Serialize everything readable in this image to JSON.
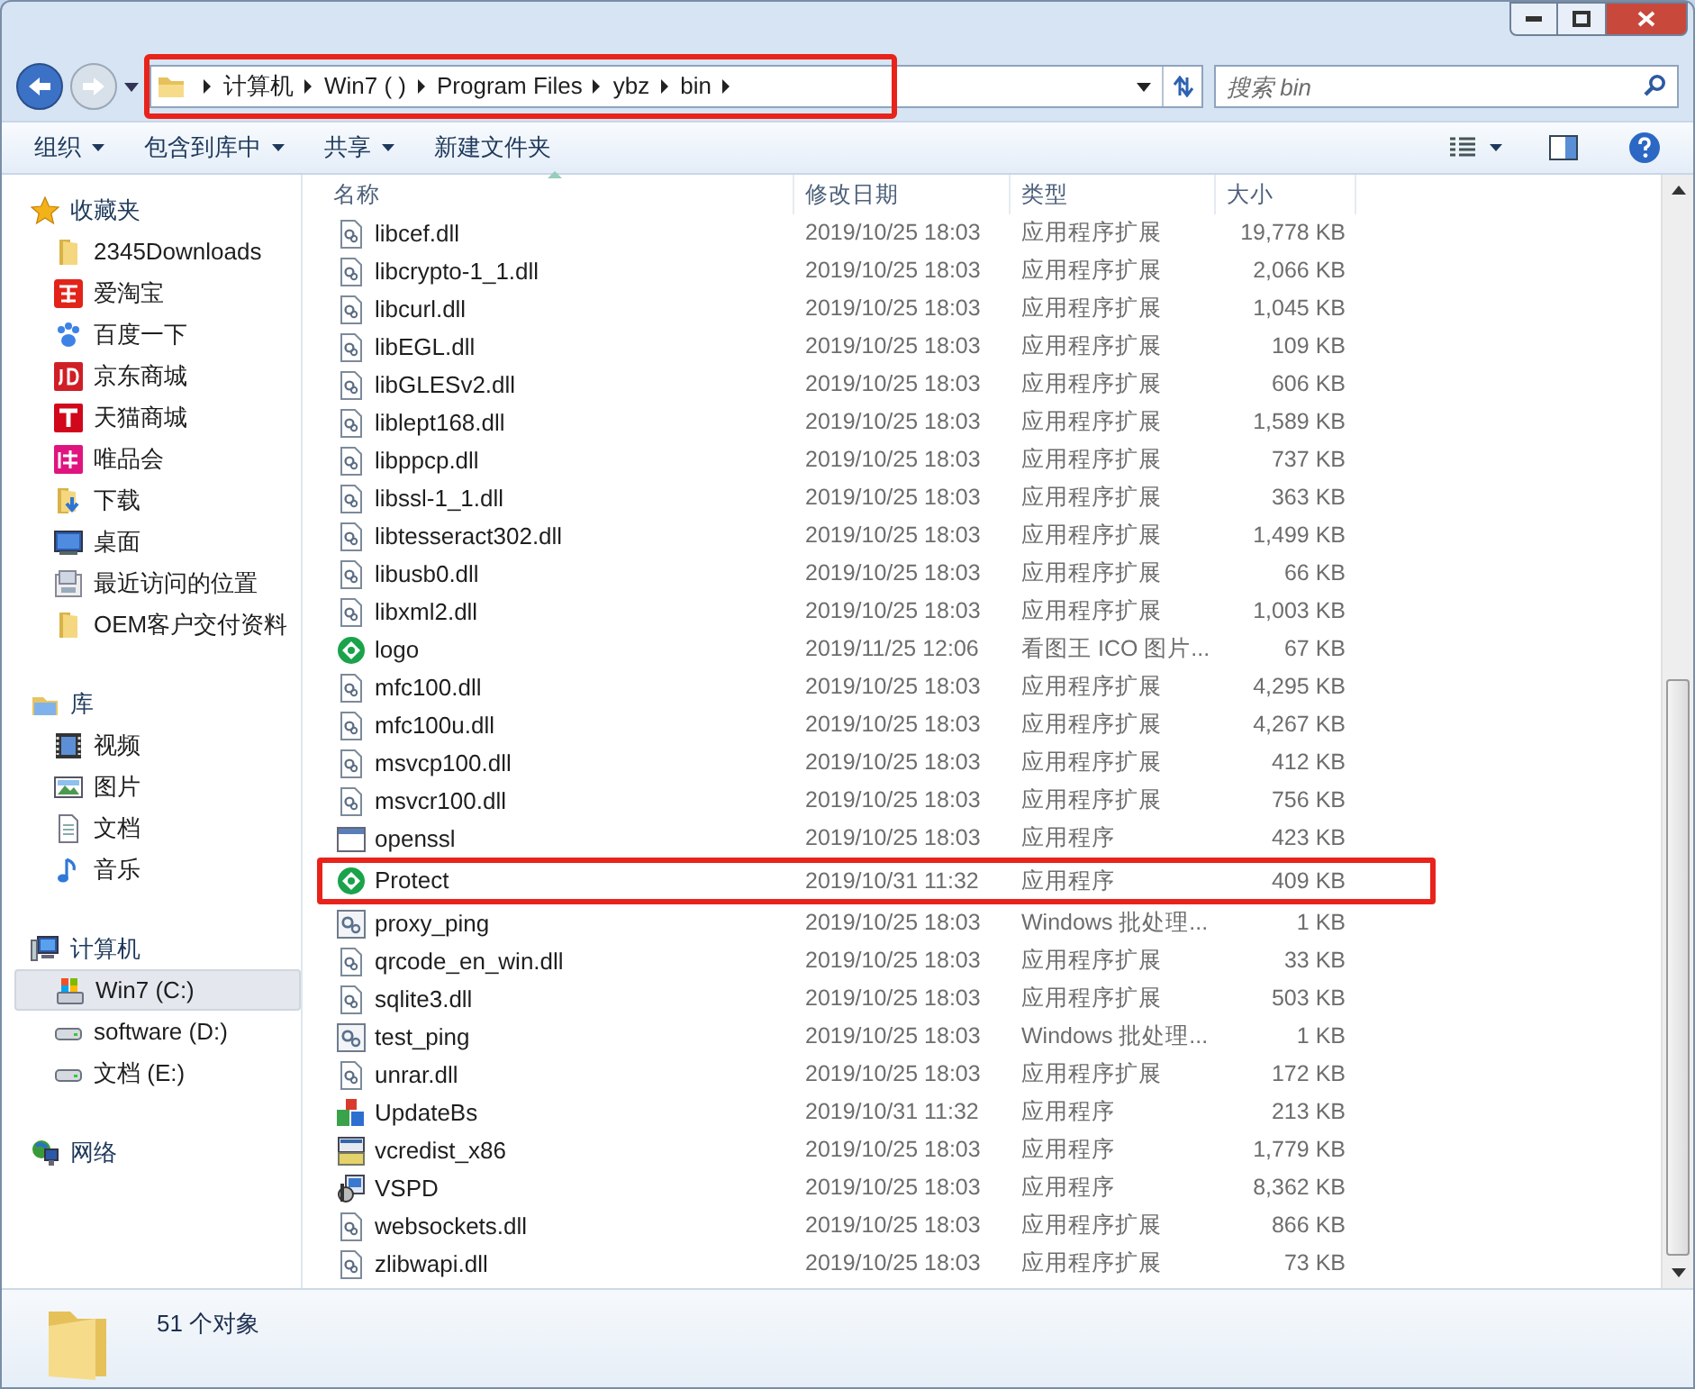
{
  "address_bar": {
    "highlighted": true,
    "segments": [
      "计算机",
      "Win7 ( )",
      "Program Files",
      "ybz",
      "bin"
    ]
  },
  "search": {
    "placeholder": "搜索 bin"
  },
  "toolbar": [
    {
      "label": "组织",
      "dropdown": true
    },
    {
      "label": "包含到库中",
      "dropdown": true
    },
    {
      "label": "共享",
      "dropdown": true
    },
    {
      "label": "新建文件夹",
      "dropdown": false
    }
  ],
  "sidebar": [
    {
      "label": "收藏夹",
      "kind": "star",
      "selected": false,
      "children": [
        {
          "label": "2345Downloads",
          "kind": "folder",
          "selected": false
        },
        {
          "label": "爱淘宝",
          "kind": "taobao",
          "selected": false
        },
        {
          "label": "百度一下",
          "kind": "paw",
          "selected": false
        },
        {
          "label": "京东商城",
          "kind": "jd",
          "selected": false
        },
        {
          "label": "天猫商城",
          "kind": "tmall",
          "selected": false
        },
        {
          "label": "唯品会",
          "kind": "vip",
          "selected": false
        },
        {
          "label": "下载",
          "kind": "download",
          "selected": false
        },
        {
          "label": "桌面",
          "kind": "desktop",
          "selected": false
        },
        {
          "label": "最近访问的位置",
          "kind": "recent",
          "selected": false
        },
        {
          "label": "OEM客户交付资料",
          "kind": "folder",
          "selected": false
        }
      ]
    },
    {
      "label": "库",
      "kind": "library",
      "selected": false,
      "children": [
        {
          "label": "视频",
          "kind": "film",
          "selected": false
        },
        {
          "label": "图片",
          "kind": "image",
          "selected": false
        },
        {
          "label": "文档",
          "kind": "doc",
          "selected": false
        },
        {
          "label": "音乐",
          "kind": "music",
          "selected": false
        }
      ]
    },
    {
      "label": "计算机",
      "kind": "computer",
      "selected": false,
      "children": [
        {
          "label": "Win7 (C:)",
          "kind": "sysdrive",
          "selected": true
        },
        {
          "label": "software (D:)",
          "kind": "drive",
          "selected": false
        },
        {
          "label": "文档 (E:)",
          "kind": "drive",
          "selected": false
        }
      ]
    },
    {
      "label": "网络",
      "kind": "network",
      "selected": false
    }
  ],
  "table": {
    "columns": [
      "名称",
      "修改日期",
      "类型",
      "大小"
    ],
    "rows": [
      {
        "name": "libcef.dll",
        "kind": "dll",
        "date": "2019/10/25 18:03",
        "type": "应用程序扩展",
        "size": "19,778 KB",
        "highlighted": false
      },
      {
        "name": "libcrypto-1_1.dll",
        "kind": "dll",
        "date": "2019/10/25 18:03",
        "type": "应用程序扩展",
        "size": "2,066 KB",
        "highlighted": false
      },
      {
        "name": "libcurl.dll",
        "kind": "dll",
        "date": "2019/10/25 18:03",
        "type": "应用程序扩展",
        "size": "1,045 KB",
        "highlighted": false
      },
      {
        "name": "libEGL.dll",
        "kind": "dll",
        "date": "2019/10/25 18:03",
        "type": "应用程序扩展",
        "size": "109 KB",
        "highlighted": false
      },
      {
        "name": "libGLESv2.dll",
        "kind": "dll",
        "date": "2019/10/25 18:03",
        "type": "应用程序扩展",
        "size": "606 KB",
        "highlighted": false
      },
      {
        "name": "liblept168.dll",
        "kind": "dll",
        "date": "2019/10/25 18:03",
        "type": "应用程序扩展",
        "size": "1,589 KB",
        "highlighted": false
      },
      {
        "name": "libppcp.dll",
        "kind": "dll",
        "date": "2019/10/25 18:03",
        "type": "应用程序扩展",
        "size": "737 KB",
        "highlighted": false
      },
      {
        "name": "libssl-1_1.dll",
        "kind": "dll",
        "date": "2019/10/25 18:03",
        "type": "应用程序扩展",
        "size": "363 KB",
        "highlighted": false
      },
      {
        "name": "libtesseract302.dll",
        "kind": "dll",
        "date": "2019/10/25 18:03",
        "type": "应用程序扩展",
        "size": "1,499 KB",
        "highlighted": false
      },
      {
        "name": "libusb0.dll",
        "kind": "dll",
        "date": "2019/10/25 18:03",
        "type": "应用程序扩展",
        "size": "66 KB",
        "highlighted": false
      },
      {
        "name": "libxml2.dll",
        "kind": "dll",
        "date": "2019/10/25 18:03",
        "type": "应用程序扩展",
        "size": "1,003 KB",
        "highlighted": false
      },
      {
        "name": "logo",
        "kind": "ring",
        "date": "2019/11/25 12:06",
        "type": "看图王 ICO 图片...",
        "size": "67 KB",
        "highlighted": false
      },
      {
        "name": "mfc100.dll",
        "kind": "dll",
        "date": "2019/10/25 18:03",
        "type": "应用程序扩展",
        "size": "4,295 KB",
        "highlighted": false
      },
      {
        "name": "mfc100u.dll",
        "kind": "dll",
        "date": "2019/10/25 18:03",
        "type": "应用程序扩展",
        "size": "4,267 KB",
        "highlighted": false
      },
      {
        "name": "msvcp100.dll",
        "kind": "dll",
        "date": "2019/10/25 18:03",
        "type": "应用程序扩展",
        "size": "412 KB",
        "highlighted": false
      },
      {
        "name": "msvcr100.dll",
        "kind": "dll",
        "date": "2019/10/25 18:03",
        "type": "应用程序扩展",
        "size": "756 KB",
        "highlighted": false
      },
      {
        "name": "openssl",
        "kind": "window",
        "date": "2019/10/25 18:03",
        "type": "应用程序",
        "size": "423 KB",
        "highlighted": false
      },
      {
        "name": "Protect",
        "kind": "ring",
        "date": "2019/10/31 11:32",
        "type": "应用程序",
        "size": "409 KB",
        "highlighted": true
      },
      {
        "name": "proxy_ping",
        "kind": "batch",
        "date": "2019/10/25 18:03",
        "type": "Windows 批处理...",
        "size": "1 KB",
        "highlighted": false
      },
      {
        "name": "qrcode_en_win.dll",
        "kind": "dll",
        "date": "2019/10/25 18:03",
        "type": "应用程序扩展",
        "size": "33 KB",
        "highlighted": false
      },
      {
        "name": "sqlite3.dll",
        "kind": "dll",
        "date": "2019/10/25 18:03",
        "type": "应用程序扩展",
        "size": "503 KB",
        "highlighted": false
      },
      {
        "name": "test_ping",
        "kind": "batch",
        "date": "2019/10/25 18:03",
        "type": "Windows 批处理...",
        "size": "1 KB",
        "highlighted": false
      },
      {
        "name": "unrar.dll",
        "kind": "dll",
        "date": "2019/10/25 18:03",
        "type": "应用程序扩展",
        "size": "172 KB",
        "highlighted": false
      },
      {
        "name": "UpdateBs",
        "kind": "blocks",
        "date": "2019/10/31 11:32",
        "type": "应用程序",
        "size": "213 KB",
        "highlighted": false
      },
      {
        "name": "vcredist_x86",
        "kind": "setup",
        "date": "2019/10/25 18:03",
        "type": "应用程序",
        "size": "1,779 KB",
        "highlighted": false
      },
      {
        "name": "VSPD",
        "kind": "installer",
        "date": "2019/10/25 18:03",
        "type": "应用程序",
        "size": "8,362 KB",
        "highlighted": false
      },
      {
        "name": "websockets.dll",
        "kind": "dll",
        "date": "2019/10/25 18:03",
        "type": "应用程序扩展",
        "size": "866 KB",
        "highlighted": false
      },
      {
        "name": "zlibwapi.dll",
        "kind": "dll",
        "date": "2019/10/25 18:03",
        "type": "应用程序扩展",
        "size": "73 KB",
        "highlighted": false
      }
    ]
  },
  "status_bar": {
    "text": "51 个对象"
  }
}
